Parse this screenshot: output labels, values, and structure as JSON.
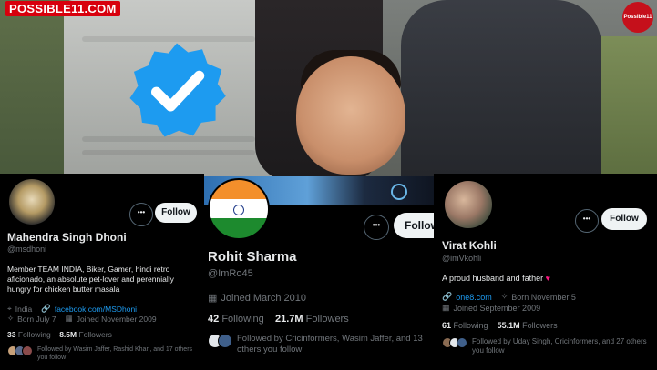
{
  "watermark": {
    "brand": "POSSIBLE11.COM",
    "corner_logo": "Possible11"
  },
  "cards": [
    {
      "name": "Mahendra Singh Dhoni",
      "handle": "@msdhoni",
      "bio": "Member TEAM INDIA, Biker, Gamer, hindi retro aficionado, an absolute pet-lover and perennially hungry for chicken butter masala",
      "location": "India",
      "link": "facebook.com/MSDhoni",
      "born": "Born July 7",
      "joined": "Joined November 2009",
      "following_count": "33",
      "following_label": "Following",
      "followers_count": "8.5M",
      "followers_label": "Followers",
      "followed_by": "Followed by Wasim Jaffer, Rashid Khan, and 17 others you follow",
      "more": "•••",
      "follow": "Follow"
    },
    {
      "name": "Rohit Sharma",
      "handle": "@ImRo45",
      "joined": "Joined March 2010",
      "following_count": "42",
      "following_label": "Following",
      "followers_count": "21.7M",
      "followers_label": "Followers",
      "followed_by": "Followed by Cricinformers, Wasim Jaffer, and 13 others you follow",
      "more": "•••",
      "follow": "Follow"
    },
    {
      "name": "Virat Kohli",
      "handle": "@imVkohli",
      "bio": "A proud husband and father",
      "link": "one8.com",
      "born": "Born November 5",
      "joined": "Joined September 2009",
      "following_count": "61",
      "following_label": "Following",
      "followers_count": "55.1M",
      "followers_label": "Followers",
      "followed_by": "Followed by Uday Singh, Cricinformers, and 27 others you follow",
      "more": "•••",
      "follow": "Follow"
    }
  ],
  "colors": {
    "accent": "#1d9bf0",
    "verified": "#1d9bf0",
    "heart": "#f91880",
    "brand": "#d8000d"
  }
}
